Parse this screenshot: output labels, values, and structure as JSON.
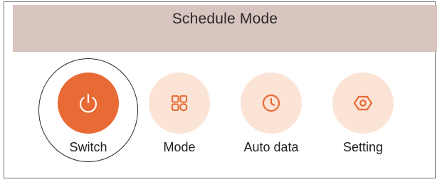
{
  "header": {
    "title": "Schedule Mode"
  },
  "controls": [
    {
      "label": "Switch",
      "icon": "power-icon",
      "active": true
    },
    {
      "label": "Mode",
      "icon": "grid-icon",
      "active": false
    },
    {
      "label": "Auto data",
      "icon": "clock-icon",
      "active": false
    },
    {
      "label": "Setting",
      "icon": "hexagon-settings-icon",
      "active": false
    }
  ],
  "colors": {
    "header_bg": "#d9c5c0",
    "accent": "#e86a34",
    "icon_bg": "#fbe3d6",
    "icon_stroke": "#e86a34"
  }
}
